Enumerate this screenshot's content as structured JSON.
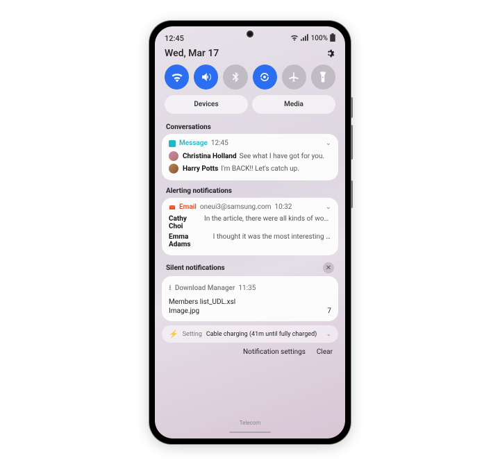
{
  "status": {
    "time": "12:45",
    "battery": "100%",
    "date": "Wed, Mar 17"
  },
  "toggles": {
    "wifi": true,
    "sound": true,
    "bluetooth": false,
    "rotate": true,
    "airplane": false,
    "flashlight": false
  },
  "chips": {
    "devices": "Devices",
    "media": "Media"
  },
  "sections": {
    "conversations": "Conversations",
    "alerting": "Alerting notifications",
    "silent": "Silent notifications"
  },
  "conversation_card": {
    "app": "Message",
    "time": "12:45",
    "items": [
      {
        "sender": "Christina Holland",
        "preview": "See what I have got for you."
      },
      {
        "sender": "Harry Potts",
        "preview": "I'm BACK!! Let's catch up."
      }
    ]
  },
  "email_card": {
    "app": "Email",
    "account": "oneui3@samsung.com",
    "time": "10:32",
    "items": [
      {
        "sender": "Cathy Choi",
        "preview": "In the article, there were all kinds of wond…"
      },
      {
        "sender": "Emma Adams",
        "preview": "I thought it was the most interesting th…"
      }
    ]
  },
  "download_card": {
    "app": "Download Manager",
    "time": "11:35",
    "files": [
      {
        "name": "Members list_UDL.xsl",
        "count": ""
      },
      {
        "name": "Image.jpg",
        "count": "7"
      }
    ]
  },
  "setting_card": {
    "app": "Setting",
    "text": "Cable charging (41m until fully charged)"
  },
  "footer": {
    "settings": "Notification settings",
    "clear": "Clear"
  },
  "brand": "Telecom"
}
